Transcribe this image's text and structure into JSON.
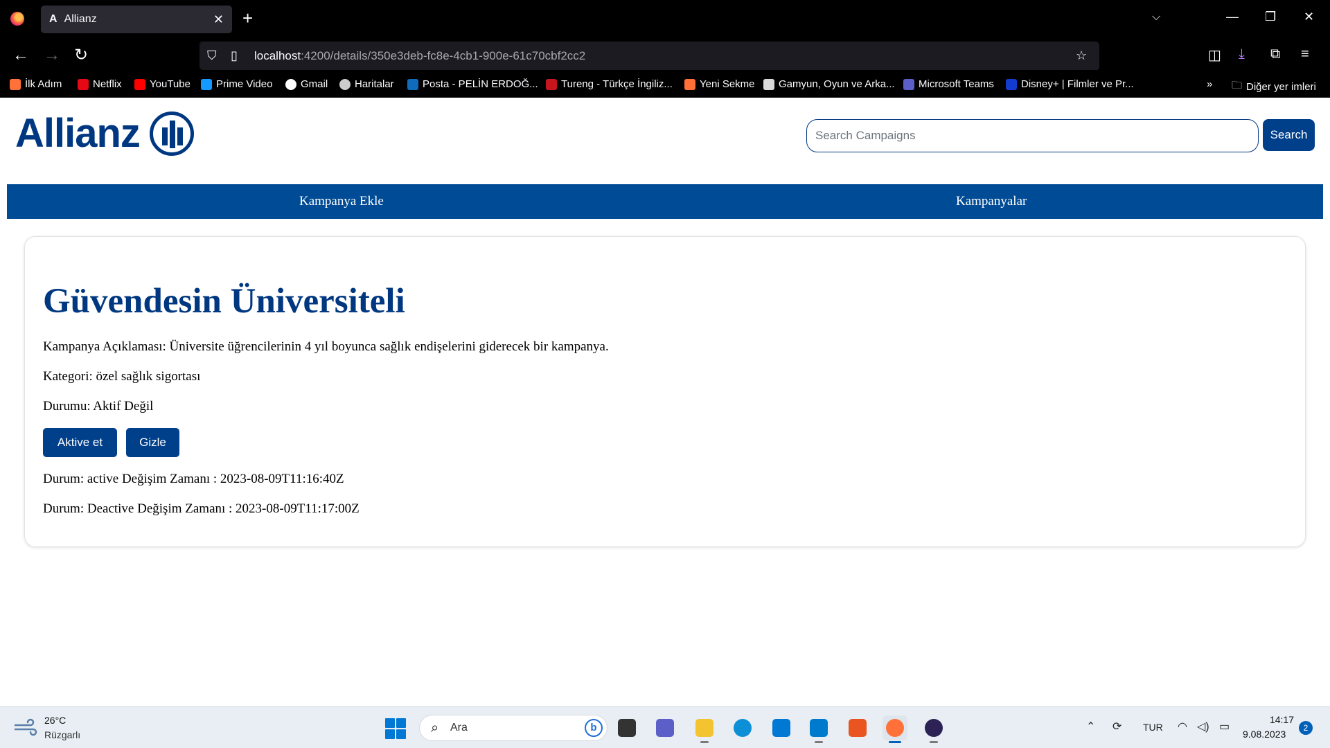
{
  "browser": {
    "tab_title": "Allianz",
    "tab_favicon": "A",
    "url_host": "localhost",
    "url_path": ":4200/details/350e3deb-fc8e-4cb1-900e-61c70cbf2cc2",
    "bookmarks": [
      {
        "label": "İlk Adım",
        "icon": "firefox-icon",
        "color": "#ff7139"
      },
      {
        "label": "Netflix",
        "icon": "netflix-icon",
        "color": "#e50914"
      },
      {
        "label": "YouTube",
        "icon": "youtube-icon",
        "color": "#ff0000"
      },
      {
        "label": "Prime Video",
        "icon": "prime-video-icon",
        "color": "#1399ff"
      },
      {
        "label": "Gmail",
        "icon": "google-icon",
        "color": "#ffffff"
      },
      {
        "label": "Haritalar",
        "icon": "globe-icon",
        "color": "#cccccc"
      },
      {
        "label": "Posta - PELİN ERDOĞ...",
        "icon": "outlook-icon",
        "color": "#0f6cbd"
      },
      {
        "label": "Tureng - Türkçe İngiliz...",
        "icon": "tureng-icon",
        "color": "#c4161c"
      },
      {
        "label": "Yeni Sekme",
        "icon": "firefox-icon",
        "color": "#ff7139"
      },
      {
        "label": "Gamyun, Oyun ve Arka...",
        "icon": "gamyun-icon",
        "color": "#d9d9d9"
      },
      {
        "label": "Microsoft Teams",
        "icon": "teams-icon",
        "color": "#5b5fc7"
      },
      {
        "label": "Disney+ | Filmler ve Pr...",
        "icon": "disney-icon",
        "color": "#113ccf"
      }
    ],
    "other_bookmarks": "Diğer yer imleri"
  },
  "header": {
    "logo_text": "Allianz",
    "search_placeholder": "Search Campaigns",
    "search_button": "Search"
  },
  "menu": {
    "items": [
      "Kampanya Ekle",
      "Kampanyalar"
    ]
  },
  "campaign": {
    "title": "Güvendesin Üniversiteli",
    "description": "Kampanya Açıklaması: Üniversite üğrencilerinin 4 yıl boyunca sağlık endişelerini giderecek bir kampanya.",
    "category": "Kategori: özel sağlık sigortası",
    "status": "Durumu: Aktif Değil",
    "activate_button": "Aktive et",
    "hide_button": "Gizle",
    "history": [
      "Durum: active Değişim Zamanı : 2023-08-09T11:16:40Z",
      "Durum: Deactive Değişim Zamanı : 2023-08-09T11:17:00Z"
    ]
  },
  "taskbar": {
    "temperature": "26°C",
    "weather": "Rüzgarlı",
    "search_label": "Ara",
    "language": "TUR",
    "time": "14:17",
    "date": "9.08.2023",
    "notification_count": "2",
    "apps": [
      {
        "name": "task-view-icon",
        "color": "#333333",
        "active": false,
        "open": false
      },
      {
        "name": "teams-chat-icon",
        "color": "#5b5fc7",
        "active": false,
        "open": false
      },
      {
        "name": "file-explorer-icon",
        "color": "#f4c430",
        "active": false,
        "open": true
      },
      {
        "name": "edge-icon",
        "color": "#0c8fd6",
        "active": false,
        "open": false
      },
      {
        "name": "mail-icon",
        "color": "#0078d4",
        "active": false,
        "open": false
      },
      {
        "name": "vscode-icon",
        "color": "#007acc",
        "active": false,
        "open": true
      },
      {
        "name": "ubuntu-icon",
        "color": "#e95420",
        "active": false,
        "open": false
      },
      {
        "name": "firefox-icon",
        "color": "#ff7139",
        "active": true,
        "open": true
      },
      {
        "name": "eclipse-icon",
        "color": "#2c2255",
        "active": false,
        "open": true
      }
    ]
  },
  "colors": {
    "brand": "#003781",
    "menu_bar": "#004b95",
    "button": "#003f8a"
  }
}
